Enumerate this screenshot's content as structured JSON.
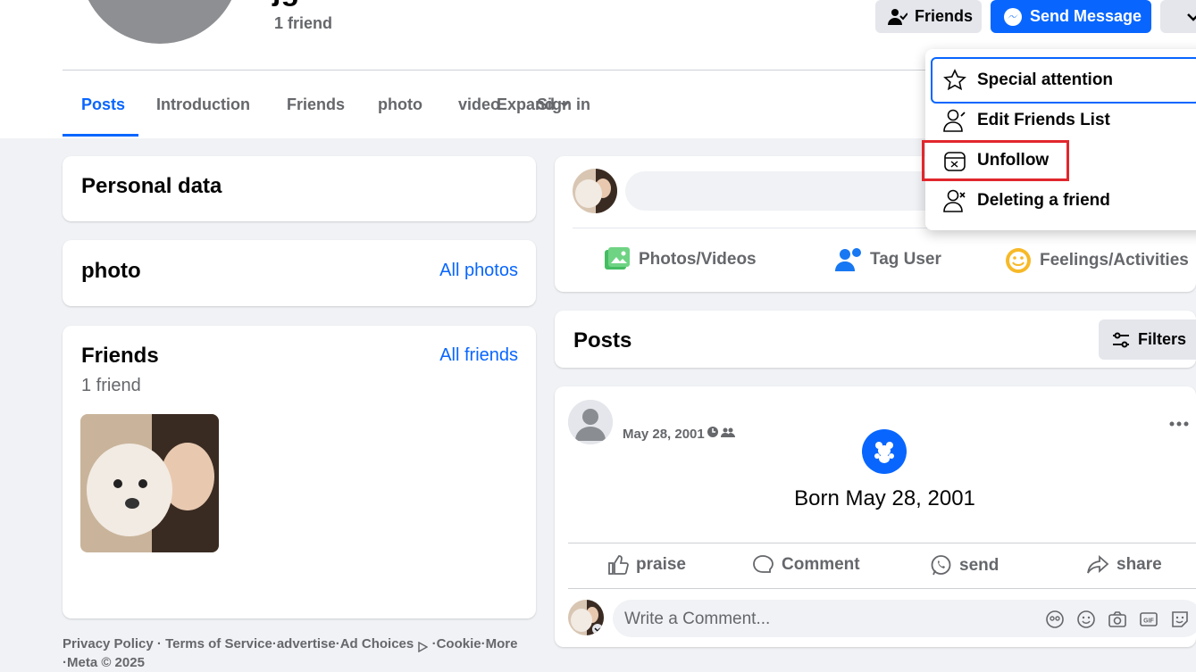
{
  "header": {
    "name_fragment": "jg",
    "friend_count": "1 friend",
    "friends_button": "Friends",
    "send_message_button": "Send Message"
  },
  "tabs": [
    {
      "label": "Posts",
      "active": true
    },
    {
      "label": "Introduction"
    },
    {
      "label": "Friends"
    },
    {
      "label": "photo"
    },
    {
      "label": "video"
    },
    {
      "label": "Expand"
    },
    {
      "label": "Sign in"
    }
  ],
  "left": {
    "personal_data_title": "Personal data",
    "photo_title": "photo",
    "all_photos_link": "All photos",
    "friends_title": "Friends",
    "friends_count": "1 friend",
    "all_friends_link": "All friends"
  },
  "composer": {
    "actions": {
      "photos": "Photos/Videos",
      "tag": "Tag User",
      "feelings": "Feelings/Activities"
    }
  },
  "posts_header": {
    "title": "Posts",
    "filters_button": "Filters"
  },
  "post": {
    "date": "May 28, 2001",
    "life_event": "Born May 28, 2001",
    "actions": {
      "praise": "praise",
      "comment": "Comment",
      "send": "send",
      "share": "share"
    },
    "comment_placeholder": "Write a Comment..."
  },
  "footer": {
    "line1": "Privacy Policy · Terms of Service·advertise·Ad Choices",
    "cookie": "·Cookie·More",
    "line2": "·Meta © 2025"
  },
  "dropdown": {
    "items": [
      {
        "label": "Special attention",
        "icon": "star-icon"
      },
      {
        "label": "Edit Friends List",
        "icon": "edit-friends-icon"
      },
      {
        "label": "Unfollow",
        "icon": "unfollow-icon"
      },
      {
        "label": "Deleting a friend",
        "icon": "remove-friend-icon"
      }
    ]
  },
  "colors": {
    "accent": "#0866ff",
    "highlight_box": "#e0272d",
    "background": "#f0f2f5"
  }
}
